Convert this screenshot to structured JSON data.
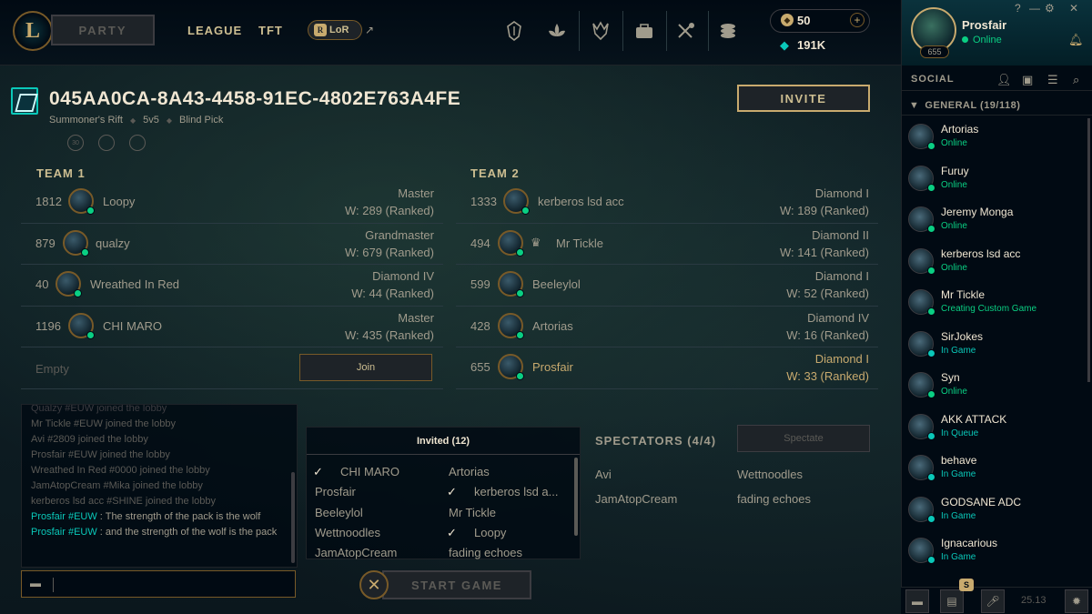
{
  "nav": {
    "logo": "L",
    "party_label": "PARTY",
    "links": [
      "LEAGUE",
      "TFT"
    ],
    "lor_label": "LoR",
    "lor_badge": "R",
    "external_glyph": "↗",
    "icons": [
      "home-crest-icon",
      "tft-icon",
      "profile-emblem-icon",
      "collection-icon",
      "loot-icon",
      "store-icon"
    ],
    "blue_essence": "50",
    "riot_points": "191K",
    "plus_glyph": "+"
  },
  "lobby": {
    "title": "045AA0CA-8A43-4458-91EC-4802E763A4FE",
    "map": "Summoner's Rift",
    "team_size": "5v5",
    "mode": "Blind Pick",
    "invite_label": "INVITE",
    "mode_icon_labels": [
      "30",
      "",
      ""
    ]
  },
  "team1": {
    "label": "TEAM 1",
    "slots": [
      {
        "lp": "1812",
        "name": "Loopy",
        "rank": "Master",
        "wins": "W: 289 (Ranked)"
      },
      {
        "lp": "879",
        "name": "qualzy",
        "rank": "Grandmaster",
        "wins": "W: 679 (Ranked)"
      },
      {
        "lp": "40",
        "name": "Wreathed In Red",
        "rank": "Diamond IV",
        "wins": "W: 44 (Ranked)"
      },
      {
        "lp": "1196",
        "name": "CHI MARO",
        "rank": "Master",
        "wins": "W: 435 (Ranked)"
      }
    ],
    "empty_label": "Empty",
    "join_label": "Join"
  },
  "team2": {
    "label": "TEAM 2",
    "slots": [
      {
        "lp": "1333",
        "name": "kerberos lsd acc",
        "rank": "Diamond I",
        "wins": "W: 189 (Ranked)"
      },
      {
        "lp": "494",
        "name": "Mr Tickle",
        "rank": "Diamond II",
        "wins": "W: 141 (Ranked)"
      },
      {
        "lp": "599",
        "name": "Beeleylol",
        "rank": "Diamond I",
        "wins": "W: 52 (Ranked)"
      },
      {
        "lp": "428",
        "name": "Artorias",
        "rank": "Diamond IV",
        "wins": "W: 16 (Ranked)"
      },
      {
        "lp": "655",
        "name": "Prosfair",
        "rank": "Diamond I",
        "wins": "W: 33 (Ranked)"
      }
    ]
  },
  "chat": {
    "partial_line": "Qualzy #EUW joined the lobby",
    "lines": [
      "Mr Tickle #EUW joined the lobby",
      "Avi #2809 joined the lobby",
      "Prosfair #EUW joined the lobby",
      "Wreathed In Red #0000 joined the lobby",
      "JamAtopCream #Mika joined the lobby",
      "kerberos lsd acc #SHINE joined the lobby"
    ],
    "messages": [
      {
        "who": "Prosfair #EUW",
        "text": " : The strength of the pack is the wolf"
      },
      {
        "who": "Prosfair #EUW",
        "text": " : and the strength of the wolf is the pack"
      }
    ],
    "input_value": ""
  },
  "invited": {
    "header": "Invited (12)",
    "left": [
      {
        "name": "CHI MARO",
        "checked": true
      },
      {
        "name": "Prosfair",
        "checked": false
      },
      {
        "name": "Beeleylol",
        "checked": false
      },
      {
        "name": "Wettnoodles",
        "checked": false
      },
      {
        "name": "JamAtopCream",
        "checked": false
      }
    ],
    "right": [
      {
        "name": "Artorias",
        "checked": false
      },
      {
        "name": "kerberos lsd a...",
        "checked": true
      },
      {
        "name": "Mr Tickle",
        "checked": false
      },
      {
        "name": "Loopy",
        "checked": true
      },
      {
        "name": "fading echoes",
        "checked": false
      }
    ],
    "check_glyph": "✓"
  },
  "spectators": {
    "title": "SPECTATORS (4/4)",
    "spectate_label": "Spectate",
    "names": [
      "Avi",
      "Wettnoodles",
      "JamAtopCream",
      "fading echoes"
    ]
  },
  "footer": {
    "start_label": "START GAME",
    "close_glyph": "✕"
  },
  "social": {
    "profile_name": "Prosfair",
    "profile_status": "Online",
    "profile_level": "655",
    "window_controls": [
      "?",
      "—",
      "⚙",
      "✕"
    ],
    "title": "SOCIAL",
    "group": "GENERAL (19/118)",
    "friends": [
      {
        "name": "Artorias",
        "status": "Online",
        "state": "online"
      },
      {
        "name": "Furuy",
        "status": "Online",
        "state": "online"
      },
      {
        "name": "Jeremy Monga",
        "status": "Online",
        "state": "online"
      },
      {
        "name": "kerberos lsd acc",
        "status": "Online",
        "state": "online"
      },
      {
        "name": "Mr Tickle",
        "status": "Creating Custom Game",
        "state": "online"
      },
      {
        "name": "SirJokes",
        "status": "In Game",
        "state": "ingame"
      },
      {
        "name": "Syn",
        "status": "Online",
        "state": "online"
      },
      {
        "name": "AKK ATTACK",
        "status": "In Queue",
        "state": "ingame"
      },
      {
        "name": "behave",
        "status": "In Game",
        "state": "ingame"
      },
      {
        "name": "GODSANE ADC",
        "status": "In Game",
        "state": "ingame"
      },
      {
        "name": "Ignacarious",
        "status": "In Game",
        "state": "ingame"
      }
    ],
    "badge": "S",
    "version": "25.13"
  },
  "colors": {
    "gold": "#c8aa6e",
    "online": "#0acf83",
    "in_game": "#0ac8b9",
    "text": "#a09b8c"
  }
}
